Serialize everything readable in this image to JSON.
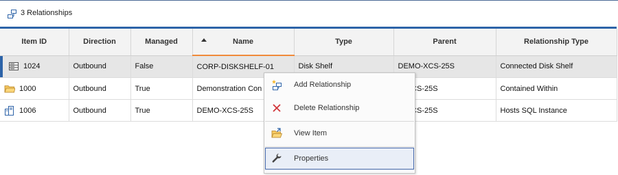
{
  "header": {
    "title": "3 Relationships",
    "icon": "relationships-icon"
  },
  "table": {
    "columns": [
      "Item ID",
      "Direction",
      "Managed",
      "Name",
      "Type",
      "Parent",
      "Relationship Type"
    ],
    "sorted_column": "Name",
    "sort_direction": "ascending",
    "rows": [
      {
        "icon": "disk-shelf-icon",
        "item_id": "1024",
        "direction": "Outbound",
        "managed": "False",
        "name": "CORP-DISKSHELF-01",
        "type": "Disk Shelf",
        "parent": "DEMO-XCS-25S",
        "relationship_type": "Connected Disk Shelf",
        "selected": true
      },
      {
        "icon": "folder-icon",
        "item_id": "1000",
        "direction": "Outbound",
        "managed": "True",
        "name": "Demonstration Con",
        "type": "",
        "parent": "O-XCS-25S",
        "relationship_type": "Contained Within",
        "selected": false
      },
      {
        "icon": "server-icon",
        "item_id": "1006",
        "direction": "Outbound",
        "managed": "True",
        "name": "DEMO-XCS-25S",
        "type": "",
        "parent": "O-XCS-25S",
        "relationship_type": "Hosts SQL Instance",
        "selected": false
      }
    ]
  },
  "context_menu": {
    "items": [
      {
        "label": "Add Relationship",
        "icon": "add-relationship-icon"
      },
      {
        "label": "Delete Relationship",
        "icon": "delete-x-icon"
      },
      {
        "label": "View Item",
        "icon": "open-folder-icon"
      },
      {
        "label": "Properties",
        "icon": "wrench-icon"
      }
    ]
  },
  "colors": {
    "accent": "#2d63a8",
    "sort_indicator": "#f08a3a",
    "delete": "#d13438"
  }
}
